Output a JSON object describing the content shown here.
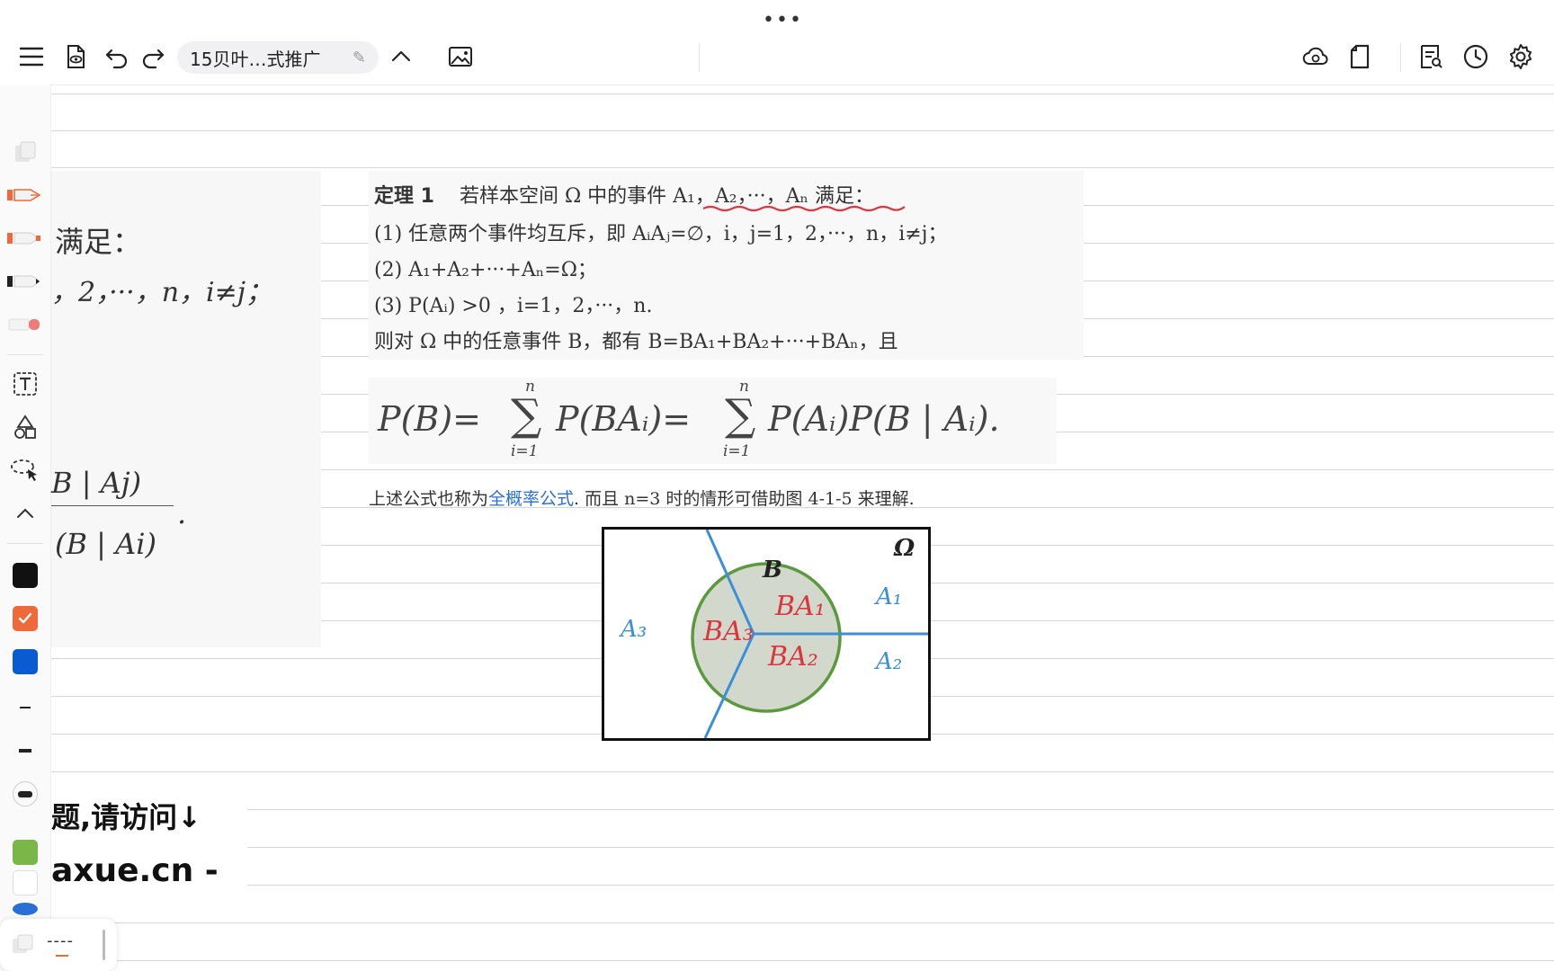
{
  "toolbar": {
    "more_glyph": "•••",
    "doc_title": "15贝叶…式推广"
  },
  "colors": {
    "accent_orange": "#ee6a3a",
    "black": "#111111",
    "blue": "#0b5bd0",
    "green": "#7ab648",
    "figure_blue": "#3a8fd8",
    "figure_red": "#d9363e",
    "figure_green": "#5b9a3c"
  },
  "sidebar": {
    "icons": [
      "layers-icon",
      "fountain-pen-icon",
      "marker-pen-icon",
      "pencil-icon",
      "eraser-icon",
      "text-box-icon",
      "shapes-icon",
      "lasso-icon",
      "collapse-icon"
    ]
  },
  "note_left": {
    "line1": "满足：",
    "line2": "，2，···，n，i≠j；",
    "line3": "B | Aj)",
    "line4": "(B | Ai)",
    "dot": "."
  },
  "theorem": {
    "label": "定理 1",
    "statement": "若样本空间 Ω 中的事件 A₁，A₂，···，Aₙ 满足：",
    "cond1": "(1) 任意两个事件均互斥，即 AᵢAⱼ=∅，i，j=1，2，···，n，i≠j；",
    "cond2": "(2) A₁+A₂+···+Aₙ=Ω；",
    "cond3": "(3) P(Aᵢ) >0 ，i=1，2，···，n.",
    "conclusion": "则对 Ω 中的任意事件 B，都有 B=BA₁+BA₂+···+BAₙ，且"
  },
  "formula": {
    "lhs": "P(B)=",
    "sum_top": "n",
    "sum_bottom": "i=1",
    "sum_symbol": "∑",
    "term1": "P(BAᵢ)=",
    "term2": "P(Aᵢ)P(B | Aᵢ)."
  },
  "caption": {
    "before": "上述公式也称为",
    "link": "全概率公式",
    "after": ".  而且 n=3 时的情形可借助图 4-1-5 来理解."
  },
  "figure": {
    "omega": "Ω",
    "b": "B",
    "a1": "A₁",
    "a2": "A₂",
    "a3": "A₃",
    "ba1": "BA₁",
    "ba2": "BA₂",
    "ba3": "BA₃"
  },
  "banner": {
    "line1": "题,请访问↓",
    "line2": "axue.cn -"
  },
  "bottombar": {
    "dashes": "----"
  }
}
